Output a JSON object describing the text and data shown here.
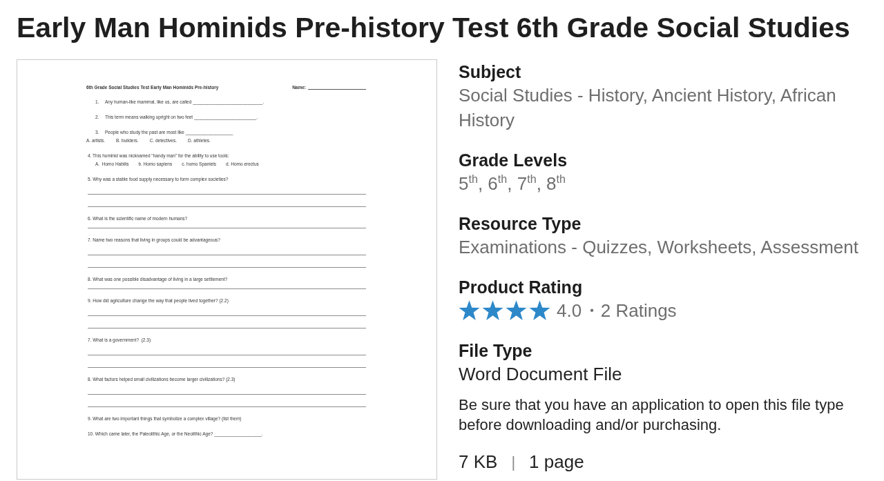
{
  "title": "Early Man Hominids Pre-history Test 6th Grade Social Studies",
  "preview": {
    "header": {
      "title": "6th Grade Social Studies Test Early Man Hominids Pre-history",
      "name_label": "Name:"
    },
    "questions": [
      {
        "kind": "text",
        "number": "1.",
        "text": "Any human-like mammal, like us, are called ____________________________."
      },
      {
        "kind": "text",
        "number": "2.",
        "text": "This term means walking upright on two feet _________________________."
      },
      {
        "kind": "text",
        "number": "3.",
        "text": "People who study the past are most like ___________________",
        "choices": [
          "A. artists.",
          "B. builders.",
          "C. detectives.",
          "D. athletes."
        ]
      },
      {
        "kind": "text",
        "text": "4. This hominid was nicknamed \"handy man\" for the ability to use tools:",
        "choices": [
          "A.  Homo Habilis",
          "b. Homo sapiens",
          "c. homo Spaniels",
          "d. Homo erectus"
        ]
      },
      {
        "kind": "long",
        "text": "5. Why was a stable food supply necessary to form complex societies?"
      },
      {
        "kind": "short",
        "text": "6. What is the scientific name of modern humans?"
      },
      {
        "kind": "long",
        "text": "7. Name two reasons that living in groups could be advantageous?"
      },
      {
        "kind": "short",
        "text": "8. What was one possible disadvantage of living in a large settlement?"
      },
      {
        "kind": "long",
        "text": "9. How did agriculture change the way that people lived together? (2.2)"
      },
      {
        "kind": "long",
        "text": "7. What is a government?  (2.3)"
      },
      {
        "kind": "long",
        "text": "8. What factors helped small civilizations become larger civilizations? (2.3)"
      },
      {
        "kind": "text",
        "text": "9. What are two important things that symbolize a complex village? (list them)"
      },
      {
        "kind": "text",
        "text": "10. Which came later, the Paleolithic Age, or the Neolithic Age? ___________________."
      }
    ]
  },
  "details": {
    "sections": [
      {
        "kind": "text",
        "label": "Subject",
        "value": "Social Studies - History, Ancient History, African History"
      },
      {
        "kind": "text",
        "label": "Grade Levels",
        "value": "5$^{th}$, 6$^{th}$, 7$^{th}$, 8$^{th}$"
      },
      {
        "kind": "text",
        "label": "Resource Type",
        "value": "Examinations - Quizzes, Worksheets, Assessment"
      },
      {
        "kind": "rating",
        "label": "Product Rating",
        "stars": 4,
        "score": "4.0",
        "separator": "•",
        "count": "2 Ratings"
      },
      {
        "kind": "file",
        "label": "File Type",
        "value": "Word Document File",
        "note": "Be sure that you have an application to open this file type before downloading and/or purchasing."
      }
    ],
    "file_info": {
      "size": "7 KB",
      "separator": "|",
      "pages": "1 page"
    }
  }
}
